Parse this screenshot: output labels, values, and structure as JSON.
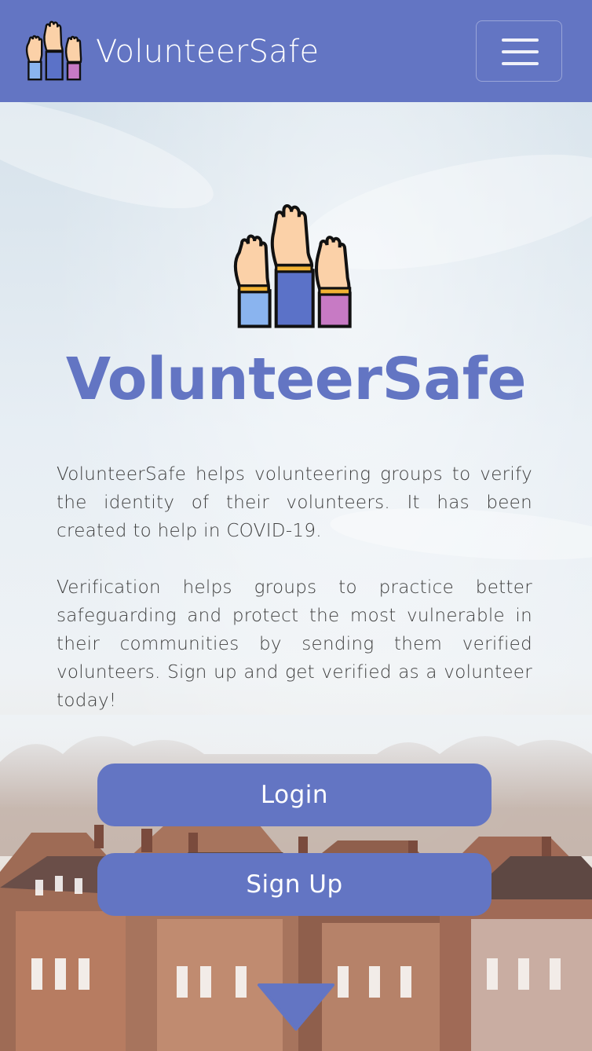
{
  "navbar": {
    "brand_name": "VolunteerSafe",
    "logo_icon": "raised-hands-icon",
    "menu_icon": "hamburger-menu-icon"
  },
  "hero": {
    "title": "VolunteerSafe",
    "paragraph1": "VolunteerSafe helps volunteering groups to verify the identity of their volunteers. It has been created to help in COVID-19.",
    "paragraph2": "Verification helps groups to practice better safeguarding and protect the most vulnerable in their communities by sending them verified volunteers. Sign up and get verified as a volunteer today!",
    "login_label": "Login",
    "signup_label": "Sign Up",
    "scroll_icon": "down-arrow-icon"
  },
  "colors": {
    "brand": "#6375c3",
    "text": "#3e3e3e",
    "button_text": "#ffffff"
  }
}
